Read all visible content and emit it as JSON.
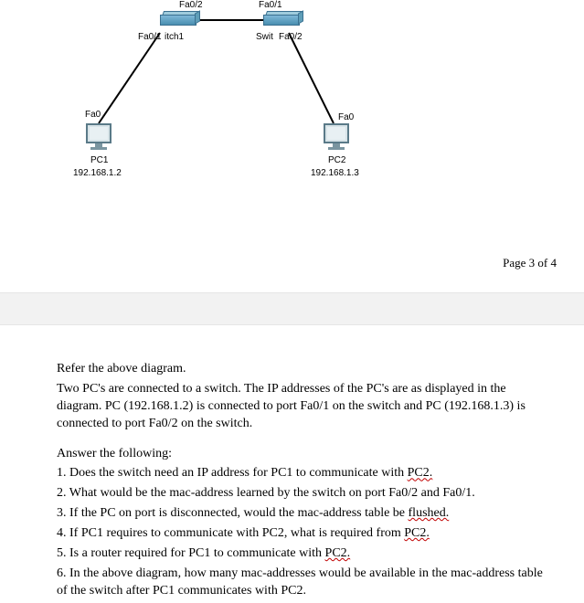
{
  "diagram": {
    "switch1": {
      "portLabel": "Fa0/2",
      "iface": "Fa0/1",
      "name": "itch1"
    },
    "switch2": {
      "portLabel": "Fa0/1",
      "name": "Swit",
      "iface": "Fa0/2"
    },
    "pc1": {
      "iface": "Fa0",
      "name": "PC1",
      "ip": "192.168.1.2"
    },
    "pc2": {
      "iface": "Fa0",
      "name": "PC2",
      "ip": "192.168.1.3"
    }
  },
  "pageLabel": "Page 3 of 4",
  "body": {
    "ref": "Refer the above diagram.",
    "desc1": "Two PC's are connected to a switch. The IP addresses of the PC's are as displayed in the diagram. PC (192.168.1.2) is connected to port Fa0/1 on the switch and PC (192.168.1.3) is connected to port Fa0/2 on the switch.",
    "answer": "Answer the following:",
    "q1a": "1. Does the switch need an IP address for PC1 to communicate with ",
    "q1b": "PC2.",
    "q2": "2. What would be the mac-address learned by the switch on port Fa0/2 and Fa0/1.",
    "q3a": "3. If the PC on port is disconnected, would the mac-address table be ",
    "q3b": "flushed.",
    "q4a": "4. If PC1 requires to communicate with PC2, what is required from ",
    "q4b": "PC2.",
    "q5a": "5. Is a router required for PC1 to communicate with ",
    "q5b": "PC2.",
    "q6": "6. In the above diagram, how many mac-addresses would be available in the mac-address table of the switch after PC1 communicates with PC2."
  }
}
